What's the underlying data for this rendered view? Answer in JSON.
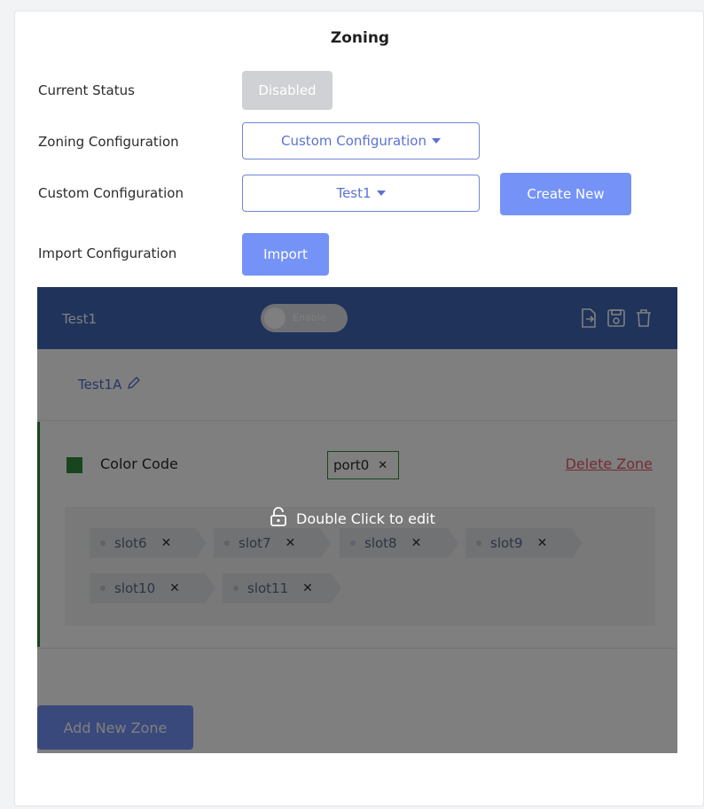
{
  "title": "Zoning",
  "rows": {
    "current_status_label": "Current Status",
    "current_status_value": "Disabled",
    "zoning_config_label": "Zoning Configuration",
    "zoning_config_value": "Custom Configuration",
    "custom_config_label": "Custom Configuration",
    "custom_config_value": "Test1",
    "create_new_label": "Create New",
    "import_config_label": "Import Configuration",
    "import_label": "Import"
  },
  "panel": {
    "name": "Test1",
    "toggle_label": "Enable",
    "tab_label": "Test1A",
    "zone": {
      "color_label": "Color Code",
      "port_chip": "port0",
      "delete_label": "Delete Zone",
      "slots": [
        "slot6",
        "slot7",
        "slot8",
        "slot9",
        "slot10",
        "slot11"
      ]
    },
    "add_zone_label": "Add New Zone",
    "edit_hint": "Double Click to edit"
  },
  "icons": {
    "caret": "caret-down-icon",
    "edit": "pencil-icon",
    "export": "export-file-icon",
    "save": "save-icon",
    "delete": "trash-icon",
    "lock": "lock-icon",
    "remove": "close-icon"
  },
  "colors": {
    "primary": "#7593f7",
    "header": "#3f67b6",
    "zone_green": "#2f8b3a",
    "delete_red": "#e85a66",
    "disabled_bg": "#cfd1d4"
  }
}
